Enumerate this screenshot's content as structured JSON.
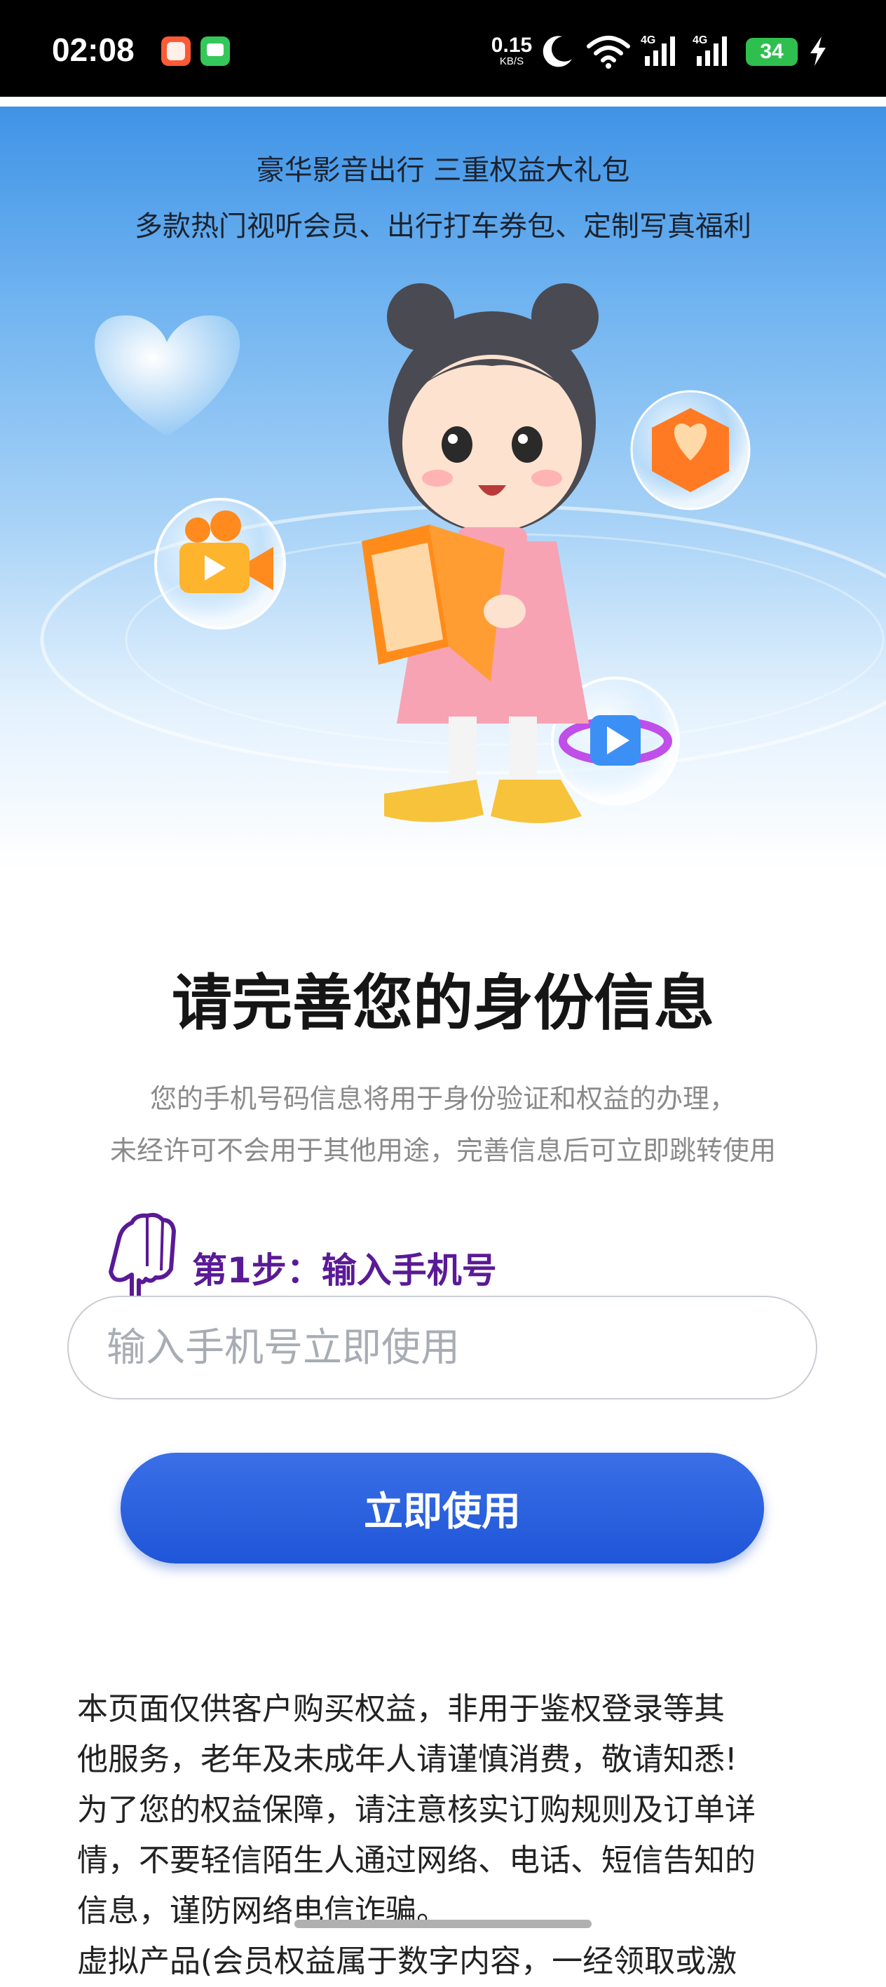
{
  "status_bar": {
    "time": "02:08",
    "net_speed_value": "0.15",
    "net_speed_unit": "KB/S",
    "signal1_label": "4G",
    "signal2_label": "4G",
    "battery": "34",
    "icons": [
      "taobao-app-icon",
      "message-app-icon",
      "moon-icon",
      "wifi-icon",
      "signal-icon",
      "signal-icon",
      "battery-icon",
      "charging-icon"
    ]
  },
  "hero": {
    "line1": "豪华影音出行 三重权益大礼包",
    "line2": "多款热门视听会员、出行打车券包、定制写真福利"
  },
  "form": {
    "title": "请完善您的身份信息",
    "desc_line1": "您的手机号码信息将用于身份验证和权益的办理，",
    "desc_line2": "未经许可不会用于其他用途，完善信息后可立即跳转使用",
    "step_label": "第1步：输入手机号",
    "phone_placeholder": "输入手机号立即使用",
    "submit_label": "立即使用"
  },
  "notice": {
    "line1": " 本页面仅供客户购买权益，非用于鉴权登录等其",
    "line2": "他服务，老年及未成年人请谨慎消费，敬请知悉!",
    "line3": "为了您的权益保障，请注意核实订购规则及订单详",
    "line4": "情，不要轻信陌生人通过网络、电话、短信告知的",
    "line5": "信息，谨防网络电信诈骗。",
    "line6": "虚拟产品(会员权益属于数字内容，一经领取或激"
  },
  "colors": {
    "primary_button": "#2a5fe0",
    "step_text": "#5a1a96",
    "hero_sky": "#4a9be8"
  }
}
